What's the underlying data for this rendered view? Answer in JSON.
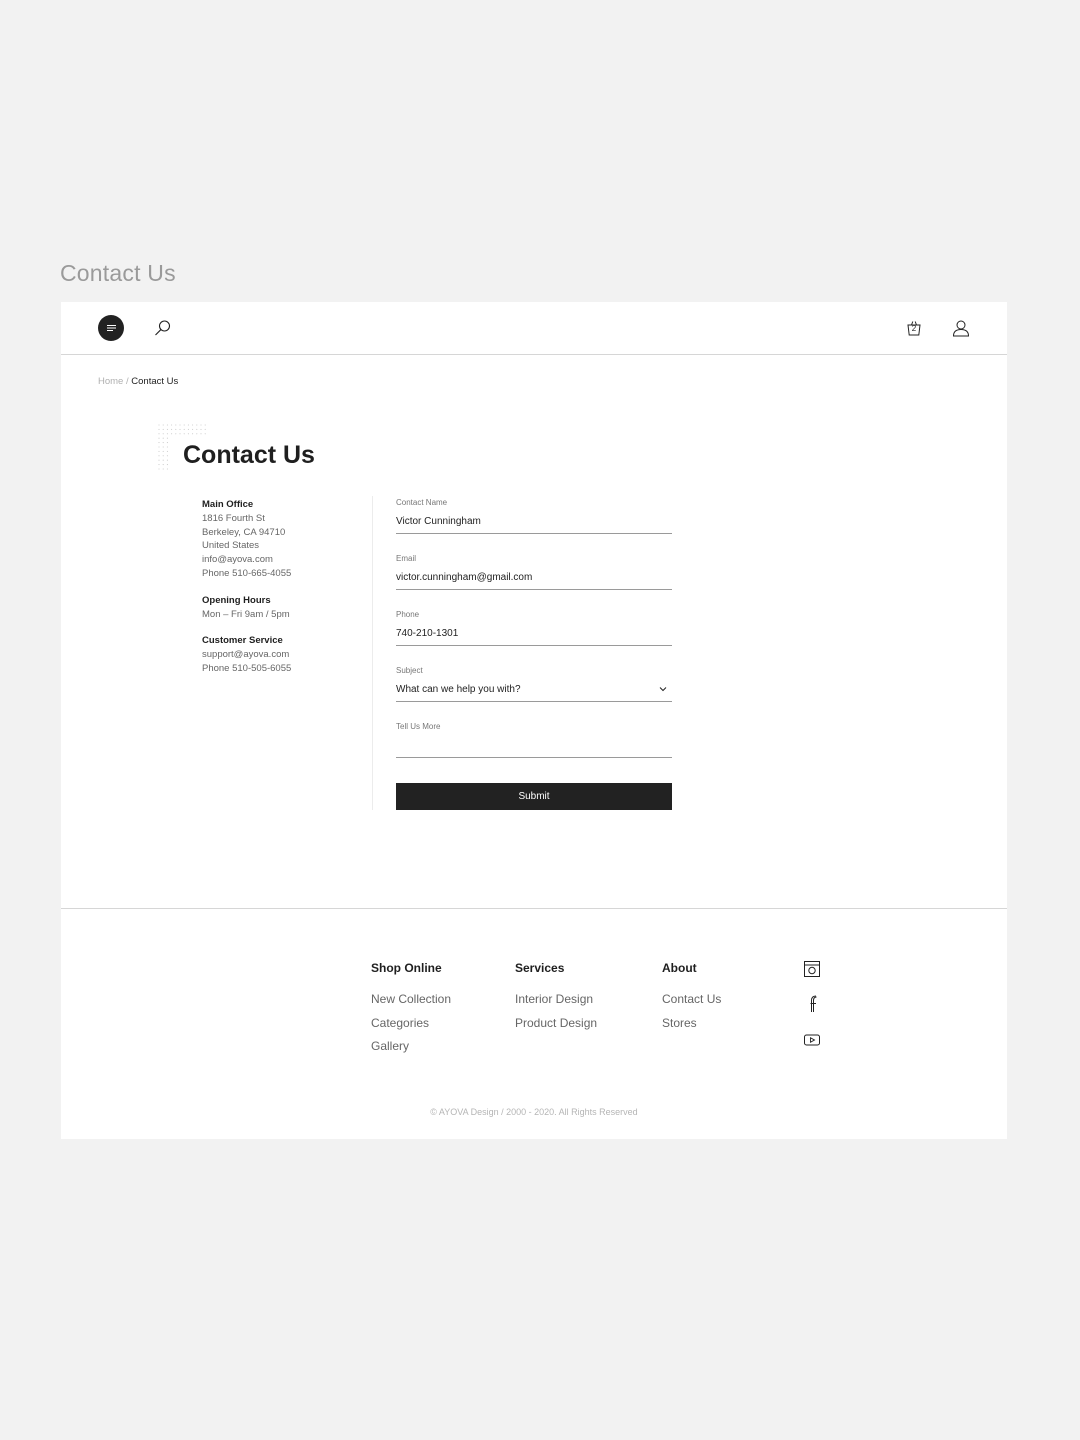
{
  "page_label": "Contact Us",
  "header": {
    "menu_icon": "menu-icon",
    "search_icon": "search-icon",
    "cart_icon": "basket-icon",
    "cart_count": "2",
    "user_icon": "user-icon"
  },
  "breadcrumb": {
    "home": "Home",
    "separator": "/",
    "current": "Contact Us"
  },
  "main": {
    "title": "Contact Us",
    "info": {
      "main_office": {
        "heading": "Main Office",
        "lines": [
          "1816 Fourth St",
          "Berkeley, CA 94710",
          "United States",
          "info@ayova.com",
          "Phone 510-665-4055"
        ]
      },
      "opening_hours": {
        "heading": "Opening Hours",
        "lines": [
          "Mon – Fri 9am / 5pm"
        ]
      },
      "customer_service": {
        "heading": "Customer Service",
        "lines": [
          "support@ayova.com",
          "Phone 510-505-6055"
        ]
      }
    },
    "form": {
      "contact_name": {
        "label": "Contact Name",
        "value": "Victor Cunningham"
      },
      "email": {
        "label": "Email",
        "value": "victor.cunningham@gmail.com"
      },
      "phone": {
        "label": "Phone",
        "value": "740-210-1301"
      },
      "subject": {
        "label": "Subject",
        "value": "What can we help you with?"
      },
      "message": {
        "label": "Tell Us More",
        "value": ""
      },
      "submit_label": "Submit"
    }
  },
  "footer": {
    "columns": [
      {
        "title": "Shop Online",
        "links": [
          "New Collection",
          "Categories",
          "Gallery"
        ]
      },
      {
        "title": "Services",
        "links": [
          "Interior Design",
          "Product Design"
        ]
      },
      {
        "title": "About",
        "links": [
          "Contact Us",
          "Stores"
        ]
      }
    ],
    "social": [
      "instagram-icon",
      "facebook-icon",
      "youtube-icon"
    ],
    "copyright": "© AYOVA Design / 2000 - 2020. All Rights Reserved"
  },
  "colors": {
    "background": "#f2f2f2",
    "surface": "#ffffff",
    "text": "#1f1f1f",
    "muted": "#666666",
    "accent": "#222222"
  }
}
